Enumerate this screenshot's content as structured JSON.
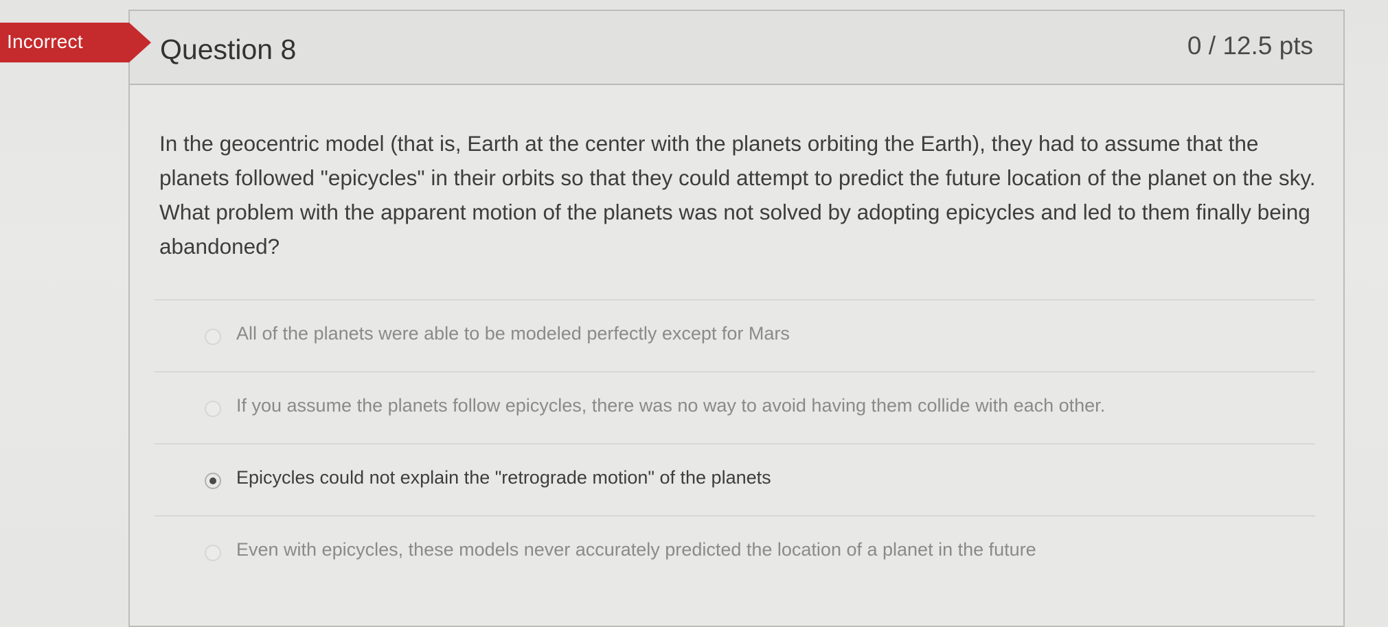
{
  "status_banner": "Incorrect",
  "question": {
    "title": "Question 8",
    "points": "0 / 12.5 pts",
    "text": "In the geocentric model (that is, Earth at the center with the planets orbiting the Earth), they had to assume that the planets followed \"epicycles\" in their orbits so that they could attempt to predict the future location of the planet on the sky. What problem with the apparent motion of the planets was not solved by adopting epicycles and led to them finally being abandoned?"
  },
  "answers": [
    {
      "label": "All of the planets were able to be modeled perfectly except for Mars",
      "selected": false
    },
    {
      "label": "If you assume the planets follow epicycles, there was no way to avoid having them collide with each other.",
      "selected": false
    },
    {
      "label": "Epicycles could not explain the \"retrograde motion\" of the planets",
      "selected": true
    },
    {
      "label": "Even with epicycles, these models never accurately predicted the location of a planet in the future",
      "selected": false
    }
  ],
  "colors": {
    "banner": "#c52a2c",
    "background": "#e6e6e4",
    "header": "#e1e1df"
  }
}
